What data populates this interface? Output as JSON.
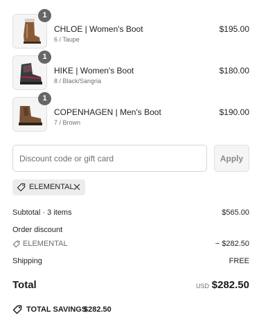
{
  "cart": {
    "items": [
      {
        "name": "CHLOE | Women's Boot",
        "variant": "6 / Taupe",
        "price": "$195.00",
        "quantity": "1",
        "icon": "brown-winter-boot-image"
      },
      {
        "name": "HIKE | Women's Boot",
        "variant": "8 / Black/Sangria",
        "price": "$180.00",
        "quantity": "1",
        "icon": "black-hiking-boot-image"
      },
      {
        "name": "COPENHAGEN | Men's Boot",
        "variant": "7 / Brown",
        "price": "$190.00",
        "quantity": "1",
        "icon": "brown-chelsea-boot-image"
      }
    ]
  },
  "discount": {
    "placeholder": "Discount code or gift card",
    "apply_label": "Apply",
    "applied_code": "ELEMENTAL"
  },
  "summary": {
    "subtotal_label": "Subtotal · 3 items",
    "subtotal_value": "$565.00",
    "order_discount_label": "Order discount",
    "discount_code": "ELEMENTAL",
    "discount_value": "− $282.50",
    "shipping_label": "Shipping",
    "shipping_value": "FREE",
    "total_label": "Total",
    "total_currency": "USD",
    "total_value": "$282.50",
    "savings_label": "TOTAL SAVINGS",
    "savings_value": "$282.50"
  },
  "colors": {
    "badge": "#666666",
    "chip_background": "#ececec",
    "text": "#1a1a1a",
    "muted_text": "#707070"
  }
}
